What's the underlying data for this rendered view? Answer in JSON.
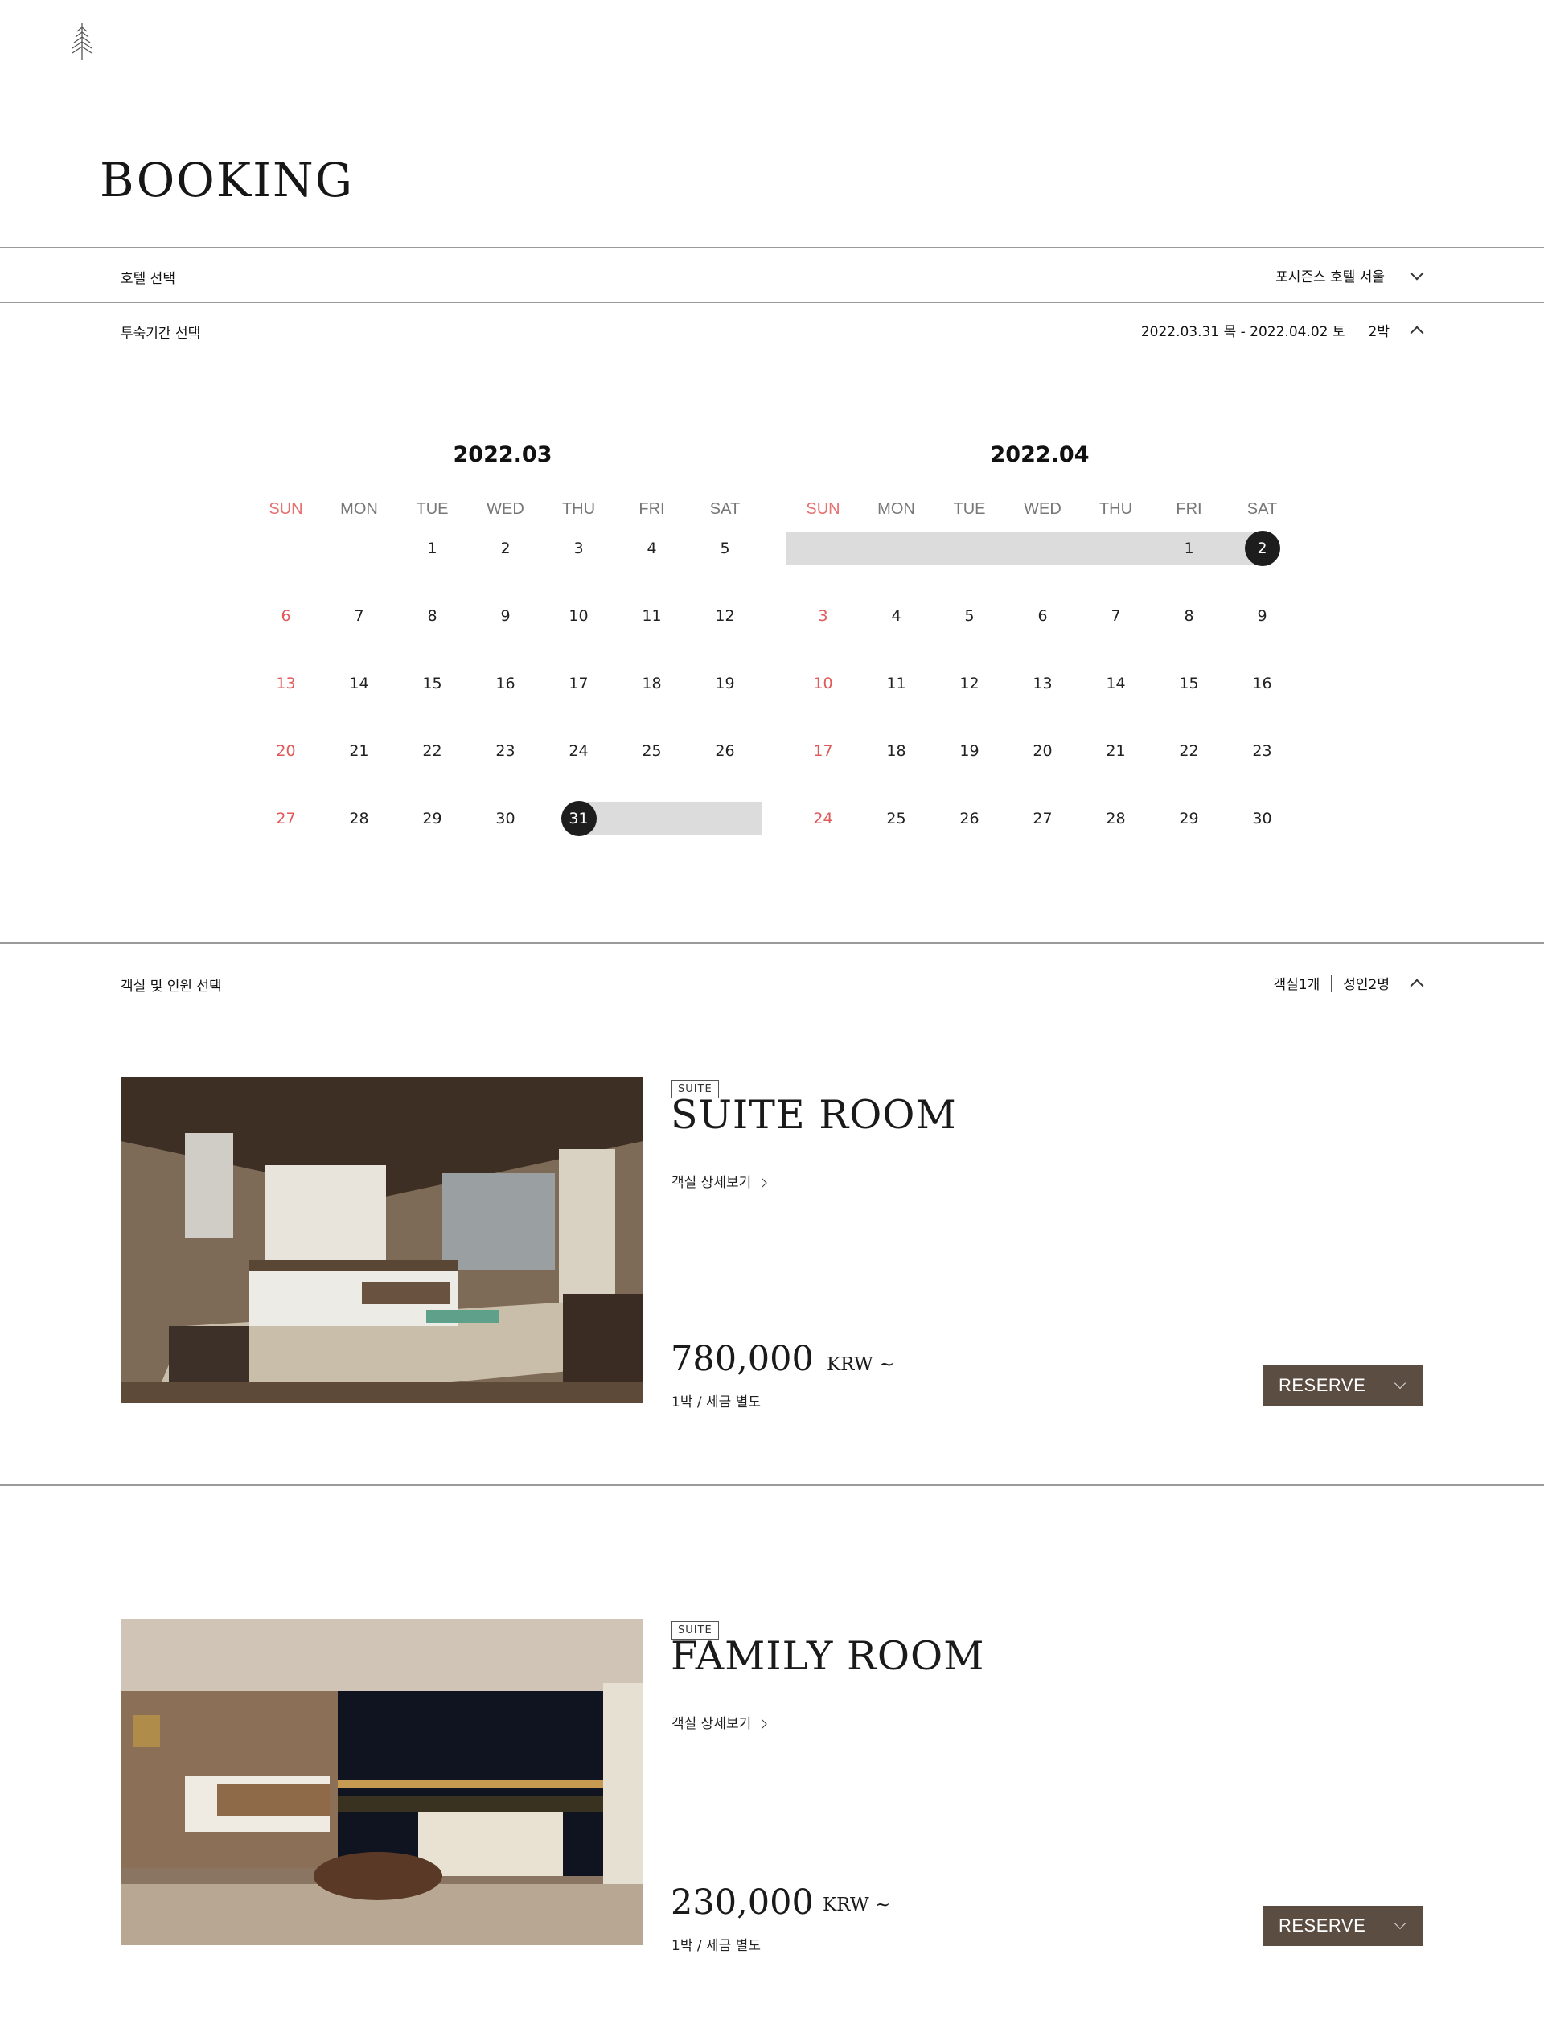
{
  "page": {
    "title": "BOOKING"
  },
  "hotel_row": {
    "label": "호텔 선택",
    "value": "포시즌스 호텔 서울"
  },
  "stay_row": {
    "label": "투숙기간 선택",
    "dates": "2022.03.31 목 - 2022.04.02 토",
    "nights": "2박"
  },
  "calendars": [
    {
      "title": "2022.03",
      "weekdays": [
        "SUN",
        "MON",
        "TUE",
        "WED",
        "THU",
        "FRI",
        "SAT"
      ],
      "rows": [
        [
          "",
          "",
          "1",
          "2",
          "3",
          "4",
          "5"
        ],
        [
          "6",
          "7",
          "8",
          "9",
          "10",
          "11",
          "12"
        ],
        [
          "13",
          "14",
          "15",
          "16",
          "17",
          "18",
          "19"
        ],
        [
          "20",
          "21",
          "22",
          "23",
          "24",
          "25",
          "26"
        ],
        [
          "27",
          "28",
          "29",
          "30",
          "31",
          "",
          ""
        ]
      ]
    },
    {
      "title": "2022.04",
      "weekdays": [
        "SUN",
        "MON",
        "TUE",
        "WED",
        "THU",
        "FRI",
        "SAT"
      ],
      "rows": [
        [
          "",
          "",
          "",
          "",
          "",
          "1",
          "2"
        ],
        [
          "3",
          "4",
          "5",
          "6",
          "7",
          "8",
          "9"
        ],
        [
          "10",
          "11",
          "12",
          "13",
          "14",
          "15",
          "16"
        ],
        [
          "17",
          "18",
          "19",
          "20",
          "21",
          "22",
          "23"
        ],
        [
          "24",
          "25",
          "26",
          "27",
          "28",
          "29",
          "30"
        ]
      ]
    }
  ],
  "room_row": {
    "label": "객실 및 인원 선택",
    "rooms": "객실1개",
    "guests": "성인2명"
  },
  "rooms": [
    {
      "badge": "SUITE",
      "name": "SUITE ROOM",
      "detail": "객실 상세보기",
      "price": "780,000",
      "currency": "KRW ~",
      "note": "1박 / 세금 별도",
      "button": "RESERVE"
    },
    {
      "badge": "SUITE",
      "name": "FAMILY ROOM",
      "detail": "객실 상세보기",
      "price": "230,000",
      "currency": "KRW ~",
      "note": "1박 / 세금 별도",
      "button": "RESERVE"
    }
  ]
}
